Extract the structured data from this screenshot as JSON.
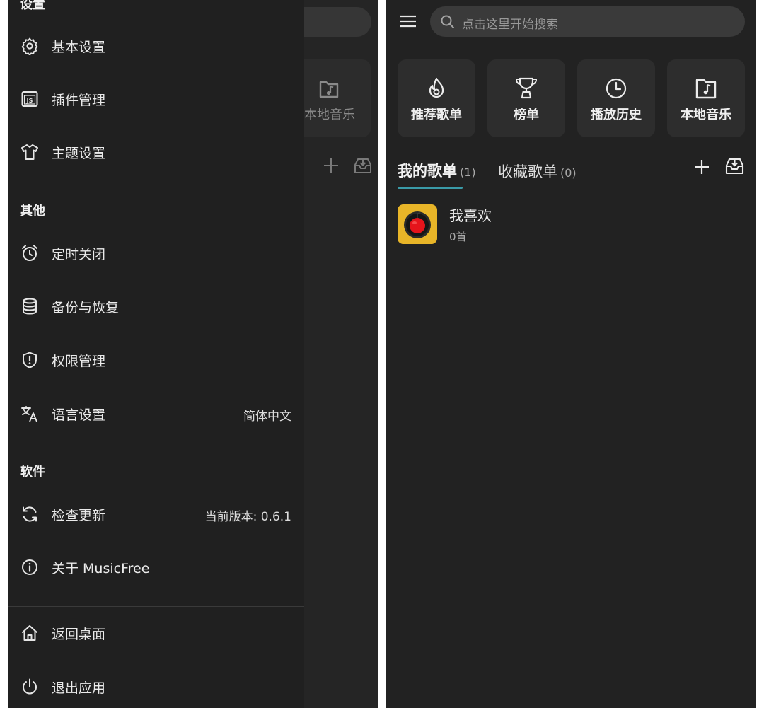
{
  "drawer": {
    "top_section_partial": "设置",
    "sections": [
      {
        "title": "其他"
      },
      {
        "title": "软件"
      }
    ],
    "items": {
      "basic_settings": {
        "label": "基本设置",
        "icon": "gear-icon"
      },
      "plugin_management": {
        "label": "插件管理",
        "icon": "js-plugin-icon"
      },
      "theme_settings": {
        "label": "主题设置",
        "icon": "shirt-icon"
      },
      "timed_close": {
        "label": "定时关闭",
        "icon": "alarm-clock-icon"
      },
      "backup_restore": {
        "label": "备份与恢复",
        "icon": "database-icon"
      },
      "permission_management": {
        "label": "权限管理",
        "icon": "shield-icon"
      },
      "language_settings": {
        "label": "语言设置",
        "value": "简体中文",
        "icon": "translate-icon"
      },
      "check_update": {
        "label": "检查更新",
        "value": "当前版本: 0.6.1",
        "icon": "refresh-icon"
      },
      "about": {
        "label": "关于 MusicFree",
        "icon": "info-icon"
      },
      "back_to_desktop": {
        "label": "返回桌面",
        "icon": "home-icon"
      },
      "exit_app": {
        "label": "退出应用",
        "icon": "power-icon"
      }
    }
  },
  "background_app": {
    "partial_card_label": "本地音乐"
  },
  "main": {
    "search": {
      "placeholder": "点击这里开始搜索"
    },
    "quick_cards": [
      {
        "label": "推荐歌单",
        "icon": "flame-icon"
      },
      {
        "label": "榜单",
        "icon": "trophy-icon"
      },
      {
        "label": "播放历史",
        "icon": "clock-icon"
      },
      {
        "label": "本地音乐",
        "icon": "music-folder-icon"
      }
    ],
    "tabs": {
      "my_playlists": {
        "label": "我的歌单",
        "count": "(1)"
      },
      "favorite_playlists": {
        "label": "收藏歌单",
        "count": "(0)"
      }
    },
    "playlists": [
      {
        "title": "我喜欢",
        "subtitle": "0首"
      }
    ]
  },
  "colors": {
    "accent": "#3a9ba8",
    "background": "#222222",
    "drawer_background": "#202020",
    "card_background": "#2d2d2d",
    "cover_yellow": "#e8b528",
    "cover_red": "#e5141b"
  }
}
